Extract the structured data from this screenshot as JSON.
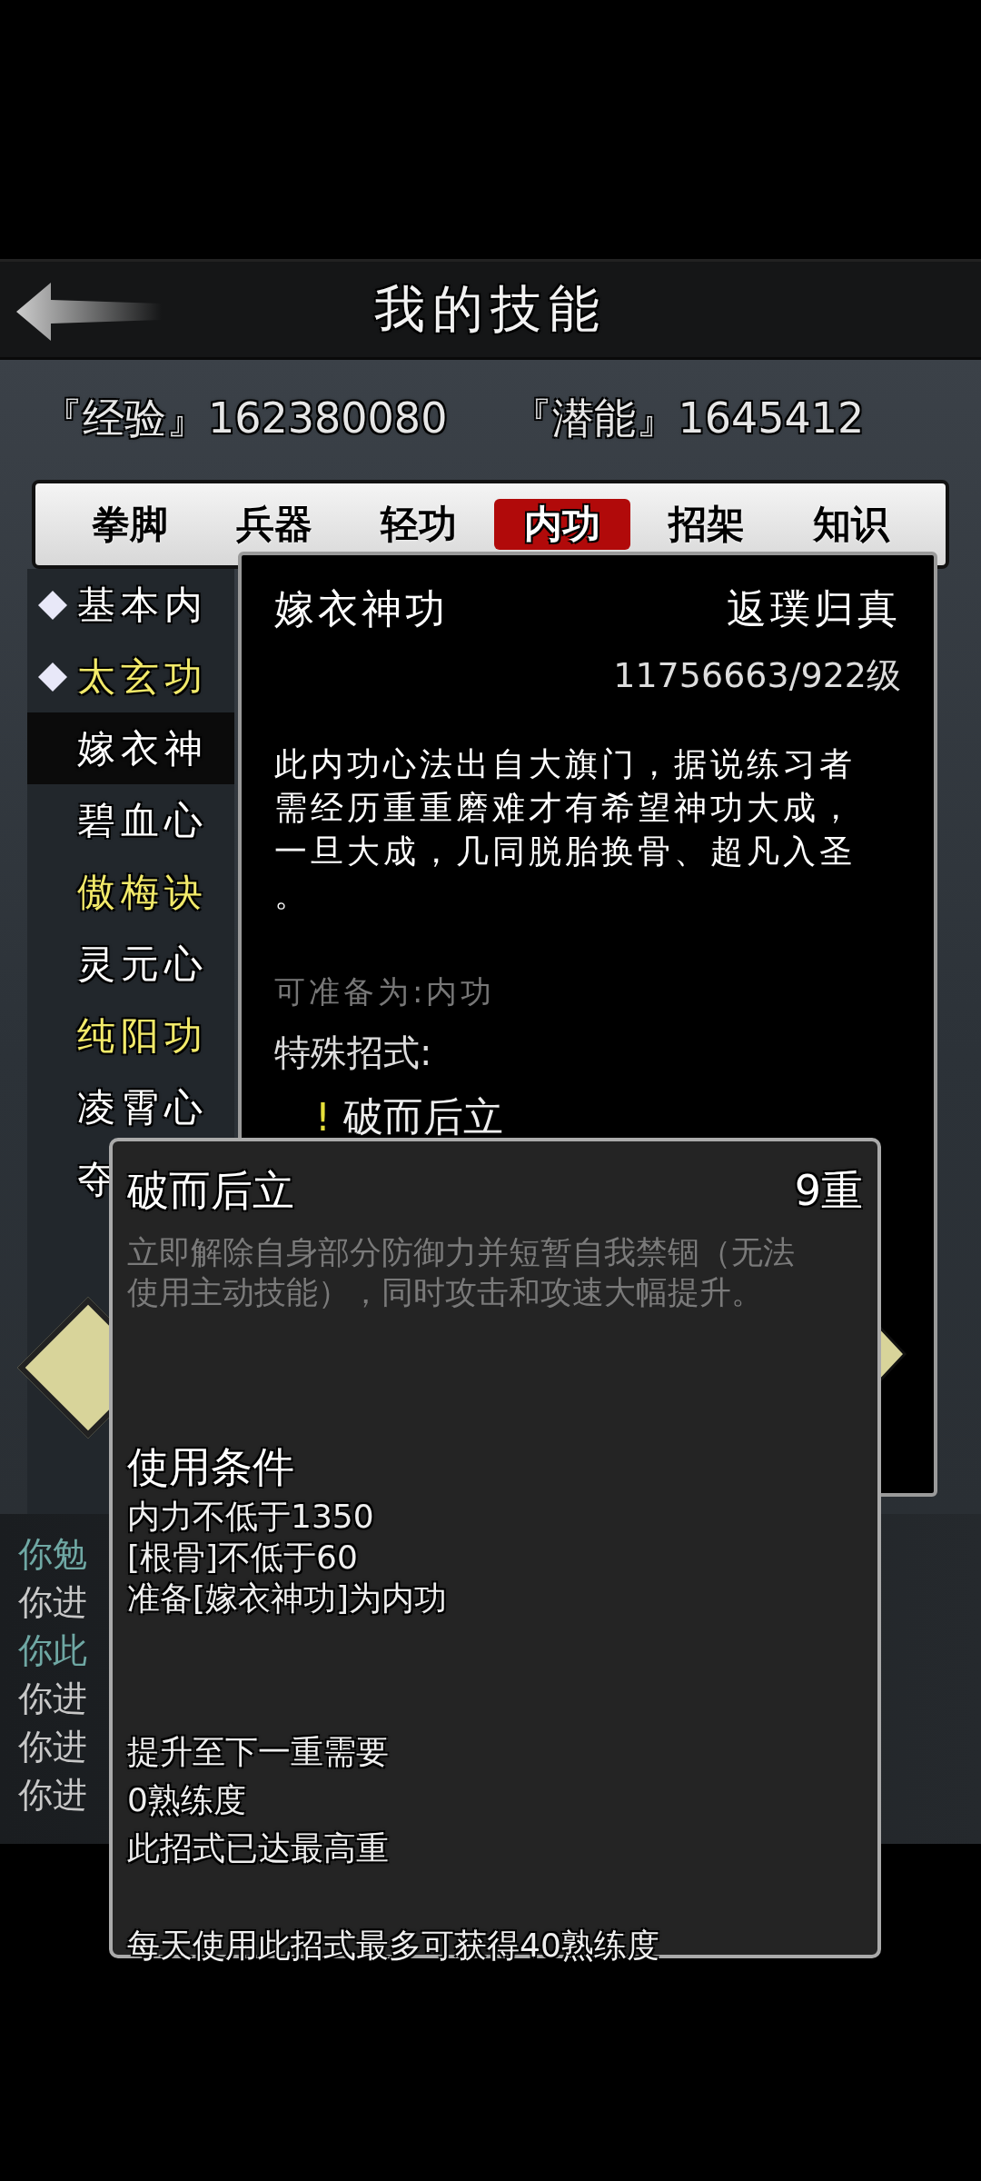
{
  "header": {
    "title": "我的技能"
  },
  "stats": [
    {
      "label": "『经验』",
      "value": "162380080"
    },
    {
      "label": "『潜能』",
      "value": "1645412"
    }
  ],
  "tabs": [
    {
      "label": "拳脚",
      "selected": false
    },
    {
      "label": "兵器",
      "selected": false
    },
    {
      "label": "轻功",
      "selected": false
    },
    {
      "label": "内功",
      "selected": true
    },
    {
      "label": "招架",
      "selected": false
    },
    {
      "label": "知识",
      "selected": false
    }
  ],
  "skills": [
    {
      "name": "基本内",
      "color": "#ffffff",
      "marked": true,
      "selected": false
    },
    {
      "name": "太玄功",
      "color": "#f2ea6a",
      "marked": true,
      "selected": false
    },
    {
      "name": "嫁衣神",
      "color": "#ffffff",
      "marked": false,
      "selected": true
    },
    {
      "name": "碧血心",
      "color": "#ffffff",
      "marked": false,
      "selected": false
    },
    {
      "name": "傲梅诀",
      "color": "#f2ea6a",
      "marked": false,
      "selected": false
    },
    {
      "name": "灵元心",
      "color": "#ffffff",
      "marked": false,
      "selected": false
    },
    {
      "name": "纯阳功",
      "color": "#f2ea6a",
      "marked": false,
      "selected": false
    },
    {
      "name": "凌霄心",
      "color": "#ffffff",
      "marked": false,
      "selected": false
    },
    {
      "name": "夺",
      "color": "#ffffff",
      "marked": false,
      "selected": false
    }
  ],
  "detail": {
    "name": "嫁衣神功",
    "rank": "返璞归真",
    "progress": "11756663/922级",
    "description_lines": [
      "此内功心法出自大旗门，据说练习者",
      "需经历重重磨难才有希望神功大成，",
      "一旦大成，几同脱胎换骨、超凡入圣",
      "。"
    ],
    "equip_as": "可准备为:内功",
    "special_title": "特殊招式:",
    "special_moves": [
      {
        "mark": "!",
        "name": "破而后立"
      }
    ]
  },
  "popup": {
    "name": "破而后立",
    "level": "9重",
    "description_lines": [
      "立即解除自身部分防御力并短暂自我禁锢（无法",
      "使用主动技能），同时攻击和攻速大幅提升。"
    ],
    "conditions_title": "使用条件",
    "conditions": [
      "内力不低于1350",
      "[根骨]不低于60",
      "准备[嫁衣神功]为内功"
    ],
    "upgrade": [
      "提升至下一重需要",
      "0熟练度",
      "此招式已达最高重"
    ],
    "daily_limit": "每天使用此招式最多可获得40熟练度"
  },
  "log": [
    {
      "text": "你勉",
      "color": "#6fa8a4"
    },
    {
      "text": "你进",
      "color": "#c8c8c8"
    },
    {
      "text": "你此",
      "color": "#6fa8a4"
    },
    {
      "text": "你进",
      "color": "#c8c8c8"
    },
    {
      "text": "你进",
      "color": "#c8c8c8"
    },
    {
      "text": "你进",
      "color": "#c8c8c8"
    }
  ]
}
